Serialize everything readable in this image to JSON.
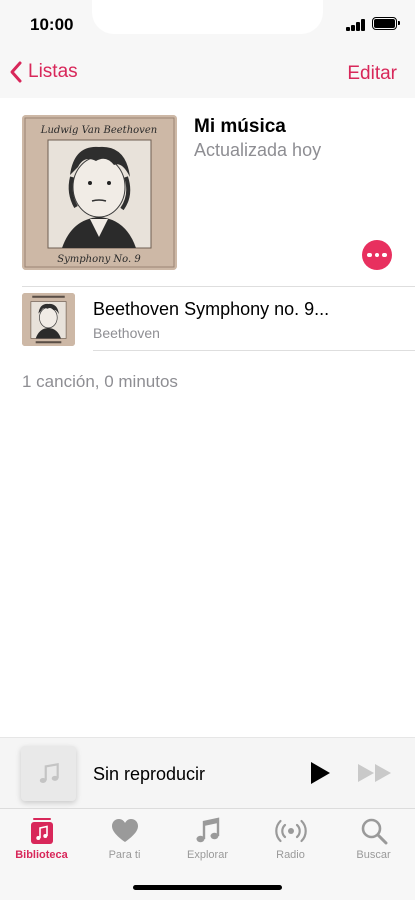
{
  "status_bar": {
    "time": "10:00"
  },
  "nav": {
    "back_label": "Listas",
    "edit_label": "Editar"
  },
  "playlist": {
    "title": "Mi música",
    "subtitle": "Actualizada hoy",
    "art": {
      "top_text": "Ludwig Van Beethoven",
      "bottom_text": "Symphony No. 9"
    }
  },
  "songs": [
    {
      "title": "Beethoven Symphony no. 9...",
      "artist": "Beethoven"
    }
  ],
  "summary": "1 canción, 0 minutos",
  "mini_player": {
    "title": "Sin reproducir"
  },
  "tabs": [
    {
      "label": "Biblioteca",
      "icon": "library-icon",
      "active": true
    },
    {
      "label": "Para ti",
      "icon": "heart-icon",
      "active": false
    },
    {
      "label": "Explorar",
      "icon": "music-note-icon",
      "active": false
    },
    {
      "label": "Radio",
      "icon": "radio-icon",
      "active": false
    },
    {
      "label": "Buscar",
      "icon": "search-icon",
      "active": false
    }
  ],
  "colors": {
    "accent": "#d8275a",
    "more_button": "#e8305f",
    "secondary_text": "#8e8e93"
  }
}
